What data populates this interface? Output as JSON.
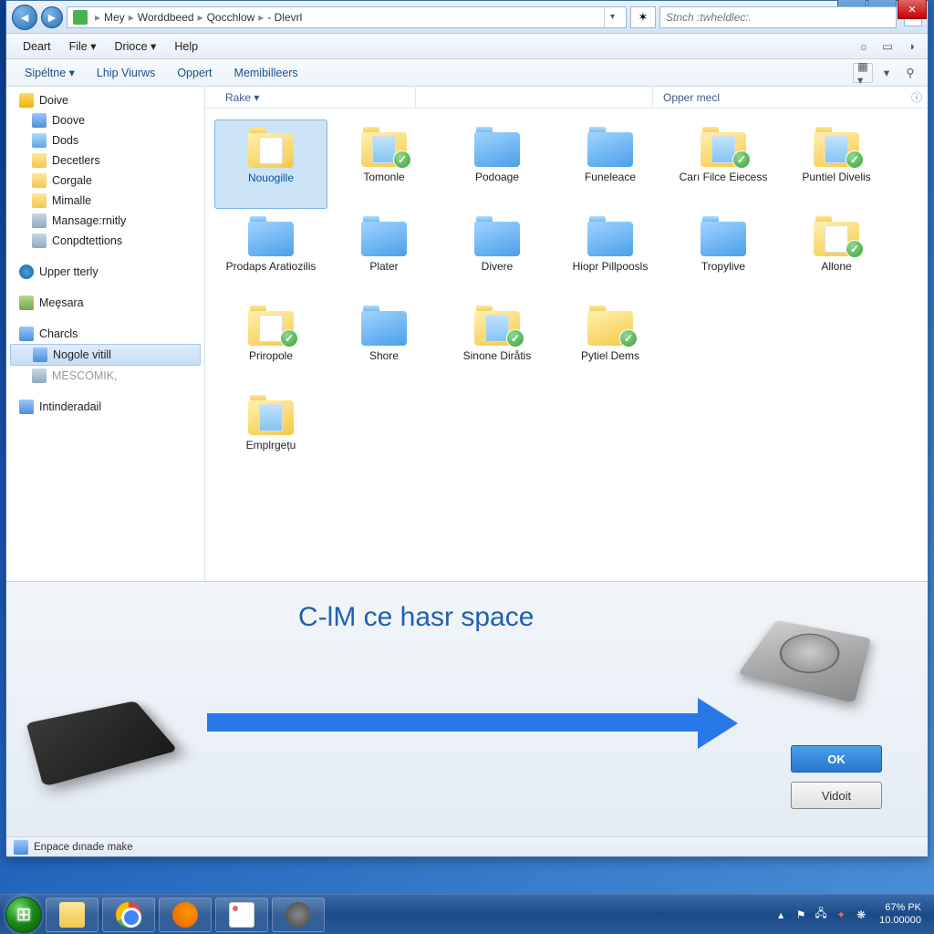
{
  "breadcrumb": {
    "p0": "Mey",
    "p1": "Worddbeed",
    "p2": "Qocchlow",
    "p3": "- Dlevrl"
  },
  "search": {
    "placeholder": "Stnch :twheldlec:."
  },
  "menubar": {
    "m0": "Deart",
    "m1": "File ▾",
    "m2": "Drioce ▾",
    "m3": "Help"
  },
  "toolbar": {
    "t0": "Sipéltne ▾",
    "t1": "Lhip Viurws",
    "t2": "Oppert",
    "t3": "Memibilleers"
  },
  "columns": {
    "c0": "Rake ▾",
    "c1": "Opper mecl"
  },
  "sidebar": {
    "root": "Doive",
    "n0": "Doove",
    "n1": "Dods",
    "n2": "Decetlers",
    "n3": "Corgale",
    "n4": "Mimalle",
    "n5": "Mansage:rnitly",
    "n6": "Conpdtettions",
    "s0": "Upper tterly",
    "s1": "Meęsara",
    "s2": "Charcls",
    "s3": "Nogole vitill",
    "s4": "MESCOMIK,",
    "s5": "Intinderadail"
  },
  "files": {
    "f0": "Nouogille",
    "f1": "Tomonle",
    "f2": "Podoage",
    "f3": "Funeleace",
    "f4": "Carı Filce Eiecess",
    "f5": "Puntiel Divelis",
    "f6": "Prodaps Aratiozilis",
    "f7": "Plater",
    "f8": "Divere",
    "f9": "Hiopr Pillpoosls",
    "f10": "Tropylive",
    "f11": "Allone",
    "f12": "Priropole",
    "f13": "Shore",
    "f14": "Sinone Diråtis",
    "f15": "Pytiel Dems",
    "f16": "Emplrgețu"
  },
  "panel": {
    "title": "C-lM ce hasr space",
    "ok": "OK",
    "cancel": "Vidoit"
  },
  "statusbar": {
    "text": "Enpace dınade make"
  },
  "tray": {
    "line1": "67% PK",
    "line2": "10.00000"
  }
}
